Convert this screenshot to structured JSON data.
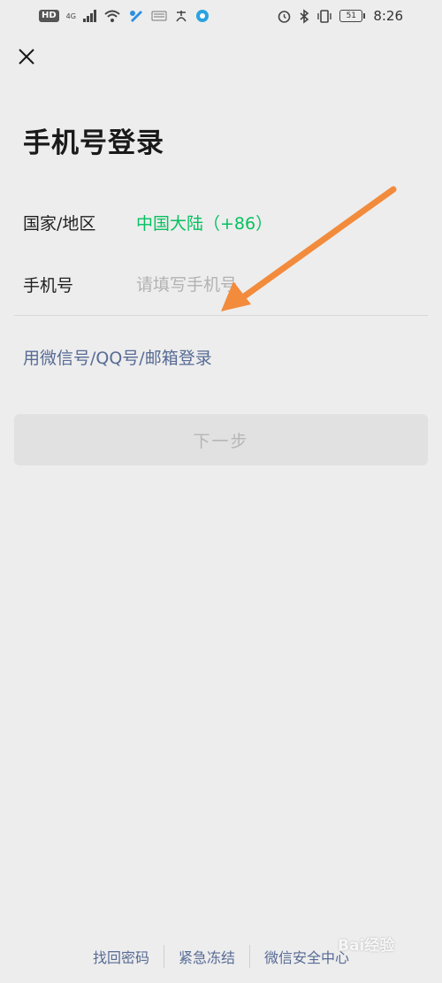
{
  "status_bar": {
    "hd": "HD",
    "network": "4G",
    "battery": "51",
    "time": "8:26"
  },
  "page": {
    "title": "手机号登录"
  },
  "form": {
    "country_label": "国家/地区",
    "country_value": "中国大陆（+86）",
    "phone_label": "手机号",
    "phone_value": "",
    "phone_placeholder": "请填写手机号",
    "alt_login": "用微信号/QQ号/邮箱登录",
    "next_button": "下一步"
  },
  "footer": {
    "links": [
      "找回密码",
      "紧急冻结",
      "微信安全中心"
    ]
  },
  "watermark": "Bai经验",
  "colors": {
    "background": "#ededed",
    "accent_green": "#07c160",
    "link_blue": "#576b95",
    "button_disabled_bg": "#e1e1e1",
    "button_disabled_text": "#b6b6b6",
    "annotation_arrow": "#f28b3c"
  },
  "icons": {
    "close": "close-icon",
    "wifi": "wifi-icon",
    "bluetooth": "bluetooth-icon",
    "alarm": "alarm-icon",
    "vibrate": "vibrate-icon"
  }
}
